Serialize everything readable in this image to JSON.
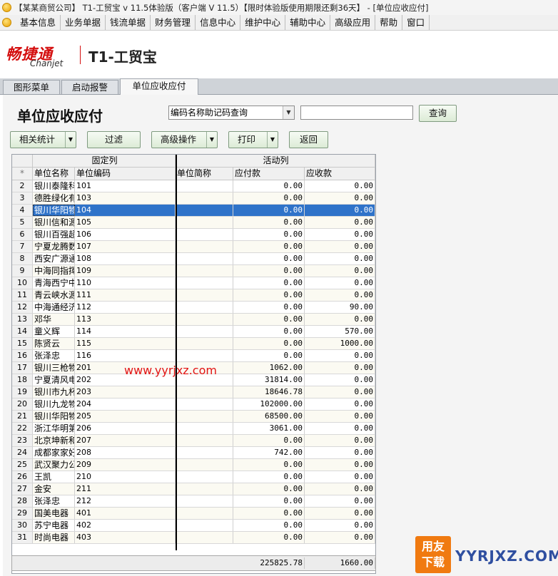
{
  "window": {
    "title": "【某某商贸公司】 T1-工贸宝 v 11.5体验版（客户端 V 11.5）【限时体验版使用期限还剩36天】 - [单位应收应付]"
  },
  "menu": [
    "基本信息",
    "业务单据",
    "钱流单据",
    "财务管理",
    "信息中心",
    "维护中心",
    "辅助中心",
    "高级应用",
    "帮助",
    "窗口"
  ],
  "brand": {
    "name_cn": "畅捷通",
    "name_en": "Chanjet",
    "product": "T1-工贸宝"
  },
  "tabs": [
    "图形菜单",
    "启动报警",
    "单位应收应付"
  ],
  "page": {
    "title": "单位应收应付",
    "search_mode": "编码名称助记码查询",
    "search_value": "",
    "query_button": "查询"
  },
  "toolbar": {
    "related_stats": "相关统计",
    "filter": "过滤",
    "advanced": "高级操作",
    "print": "打印",
    "back": "返回"
  },
  "grid": {
    "group_fixed": "固定列",
    "group_active": "活动列",
    "header_marker": "*",
    "columns": [
      "单位名称",
      "单位编码",
      "单位简称",
      "应付款",
      "应收款"
    ],
    "selected_row_no": "4",
    "rows": [
      {
        "no": "2",
        "name": "银川泰隆科",
        "code": "101",
        "abbr": "",
        "pay": "0.00",
        "rec": "0.00"
      },
      {
        "no": "3",
        "name": "德胜绿化有",
        "code": "103",
        "abbr": "",
        "pay": "0.00",
        "rec": "0.00"
      },
      {
        "no": "4",
        "name": "银川华阳物",
        "code": "104",
        "abbr": "",
        "pay": "0.00",
        "rec": "0.00"
      },
      {
        "no": "5",
        "name": "银川信和源",
        "code": "105",
        "abbr": "",
        "pay": "0.00",
        "rec": "0.00"
      },
      {
        "no": "6",
        "name": "银川百强超",
        "code": "106",
        "abbr": "",
        "pay": "0.00",
        "rec": "0.00"
      },
      {
        "no": "7",
        "name": "宁夏龙腾数",
        "code": "107",
        "abbr": "",
        "pay": "0.00",
        "rec": "0.00"
      },
      {
        "no": "8",
        "name": "西安广源通",
        "code": "108",
        "abbr": "",
        "pay": "0.00",
        "rec": "0.00"
      },
      {
        "no": "9",
        "name": "中海同指挥",
        "code": "109",
        "abbr": "",
        "pay": "0.00",
        "rec": "0.00"
      },
      {
        "no": "10",
        "name": "青海西宁中",
        "code": "110",
        "abbr": "",
        "pay": "0.00",
        "rec": "0.00"
      },
      {
        "no": "11",
        "name": "青云峡水源",
        "code": "111",
        "abbr": "",
        "pay": "0.00",
        "rec": "0.00"
      },
      {
        "no": "12",
        "name": "中海通经济",
        "code": "112",
        "abbr": "",
        "pay": "0.00",
        "rec": "90.00"
      },
      {
        "no": "13",
        "name": "邓华",
        "code": "113",
        "abbr": "",
        "pay": "0.00",
        "rec": "0.00"
      },
      {
        "no": "14",
        "name": "童义辉",
        "code": "114",
        "abbr": "",
        "pay": "0.00",
        "rec": "570.00"
      },
      {
        "no": "15",
        "name": "陈贤云",
        "code": "115",
        "abbr": "",
        "pay": "0.00",
        "rec": "1000.00"
      },
      {
        "no": "16",
        "name": "张泽忠",
        "code": "116",
        "abbr": "",
        "pay": "0.00",
        "rec": "0.00"
      },
      {
        "no": "17",
        "name": "银川三枪物",
        "code": "201",
        "abbr": "",
        "pay": "1062.00",
        "rec": "0.00"
      },
      {
        "no": "18",
        "name": "宁夏清风电",
        "code": "202",
        "abbr": "",
        "pay": "31814.00",
        "rec": "0.00"
      },
      {
        "no": "19",
        "name": "银川市九杯",
        "code": "203",
        "abbr": "",
        "pay": "18646.78",
        "rec": "0.00"
      },
      {
        "no": "20",
        "name": "银川九龙物",
        "code": "204",
        "abbr": "",
        "pay": "102000.00",
        "rec": "0.00"
      },
      {
        "no": "21",
        "name": "银川华阳物",
        "code": "205",
        "abbr": "",
        "pay": "68500.00",
        "rec": "0.00"
      },
      {
        "no": "22",
        "name": "浙江华明第",
        "code": "206",
        "abbr": "",
        "pay": "3061.00",
        "rec": "0.00"
      },
      {
        "no": "23",
        "name": "北京坤新和",
        "code": "207",
        "abbr": "",
        "pay": "0.00",
        "rec": "0.00"
      },
      {
        "no": "24",
        "name": "成都家家好",
        "code": "208",
        "abbr": "",
        "pay": "742.00",
        "rec": "0.00"
      },
      {
        "no": "25",
        "name": "武汉聚力公",
        "code": "209",
        "abbr": "",
        "pay": "0.00",
        "rec": "0.00"
      },
      {
        "no": "26",
        "name": "王凯",
        "code": "210",
        "abbr": "",
        "pay": "0.00",
        "rec": "0.00"
      },
      {
        "no": "27",
        "name": "金安",
        "code": "211",
        "abbr": "",
        "pay": "0.00",
        "rec": "0.00"
      },
      {
        "no": "28",
        "name": "张泽忠",
        "code": "212",
        "abbr": "",
        "pay": "0.00",
        "rec": "0.00"
      },
      {
        "no": "29",
        "name": "国美电器",
        "code": "401",
        "abbr": "",
        "pay": "0.00",
        "rec": "0.00"
      },
      {
        "no": "30",
        "name": "苏宁电器",
        "code": "402",
        "abbr": "",
        "pay": "0.00",
        "rec": "0.00"
      },
      {
        "no": "31",
        "name": "时尚电器",
        "code": "403",
        "abbr": "",
        "pay": "0.00",
        "rec": "0.00"
      }
    ],
    "totals": {
      "pay": "225825.78",
      "rec": "1660.00"
    }
  },
  "watermarks": {
    "site": "www.yyrjxz.com",
    "badge_line1": "用友",
    "badge_line2": "下载",
    "domain": "YYRJXZ.COM"
  },
  "colors": {
    "selection": "#2f73c9",
    "brand_red": "#d40e0e",
    "button_green": "#dcebd6"
  }
}
